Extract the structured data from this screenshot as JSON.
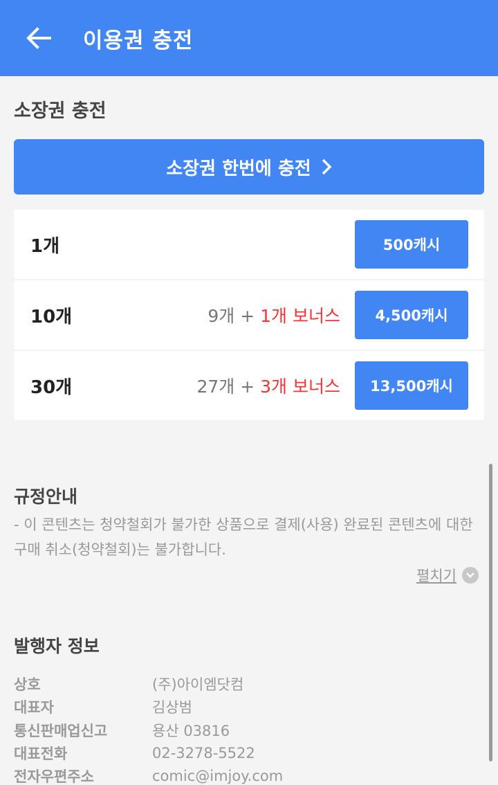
{
  "appbar": {
    "title": "이용권 충전",
    "back_icon": "arrow-left-icon"
  },
  "charge_section": {
    "title": "소장권 충전",
    "charge_all_label": "소장권 한번에 충전",
    "chevron_icon": "chevron-right-icon",
    "items": [
      {
        "count": "1개",
        "base": "",
        "plus": "",
        "bonus": "",
        "price": "500캐시"
      },
      {
        "count": "10개",
        "base": "9개",
        "plus": "+",
        "bonus": "1개 보너스",
        "price": "4,500캐시"
      },
      {
        "count": "30개",
        "base": "27개",
        "plus": "+",
        "bonus": "3개 보너스",
        "price": "13,500캐시"
      }
    ]
  },
  "policy": {
    "title": "규정안내",
    "text": "- 이 콘텐츠는 청약철회가 불가한 상품으로 결제(사용) 완료된 콘텐츠에 대한 구매 취소(청약철회)는 불가합니다.",
    "expand_label": "펼치기",
    "expand_icon": "chevron-down-circle-icon"
  },
  "publisher": {
    "title": "발행자 정보",
    "rows": [
      {
        "label": "상호",
        "value": "(주)아이엠닷컴"
      },
      {
        "label": "대표자",
        "value": "김상범"
      },
      {
        "label": "통신판매업신고",
        "value": "용산 03816"
      },
      {
        "label": "대표전화",
        "value": "02-3278-5522"
      },
      {
        "label": "전자우편주소",
        "value": "comic@imjoy.com"
      }
    ]
  },
  "colors": {
    "primary": "#4286f4",
    "bonus": "#f0343a",
    "background": "#f4f4f4"
  }
}
